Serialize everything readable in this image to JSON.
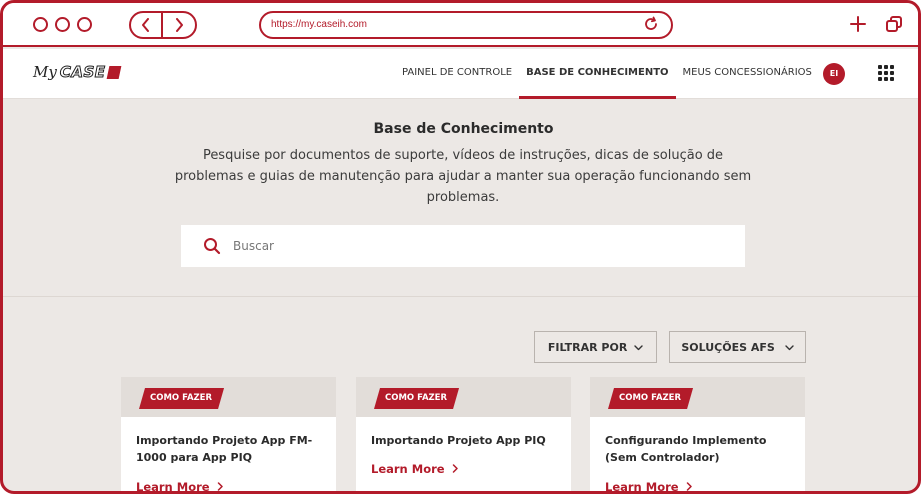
{
  "browser": {
    "url": "https://my.caseih.com"
  },
  "site": {
    "logo_my": "My",
    "logo_brand": "CASE",
    "nav": [
      {
        "label": "PAINEL DE CONTROLE",
        "active": false
      },
      {
        "label": "BASE DE CONHECIMENTO",
        "active": true
      },
      {
        "label": "MEUS CONCESSIONÁRIOS",
        "active": false
      }
    ],
    "avatar_initials": "EI"
  },
  "hero": {
    "title": "Base de Conhecimento",
    "description": "Pesquise por documentos de suporte, vídeos de instruções, dicas de solução de problemas e guias de manutenção para ajudar a manter sua operação funcionando sem problemas."
  },
  "search": {
    "placeholder": "Buscar",
    "value": ""
  },
  "filters": {
    "filter_label": "FILTRAR POR",
    "solutions_label": "SOLUÇÕES AFS"
  },
  "cards": [
    {
      "tag": "COMO FAZER",
      "title": "Importando Projeto App FM-1000 para App PIQ",
      "link": "Learn More"
    },
    {
      "tag": "COMO FAZER",
      "title": "Importando Projeto App PIQ",
      "link": "Learn More"
    },
    {
      "tag": "COMO FAZER",
      "title": "Configurando Implemento (Sem Controlador)",
      "link": "Learn More"
    }
  ],
  "colors": {
    "accent": "#b31b2a",
    "background": "#ece8e5"
  }
}
